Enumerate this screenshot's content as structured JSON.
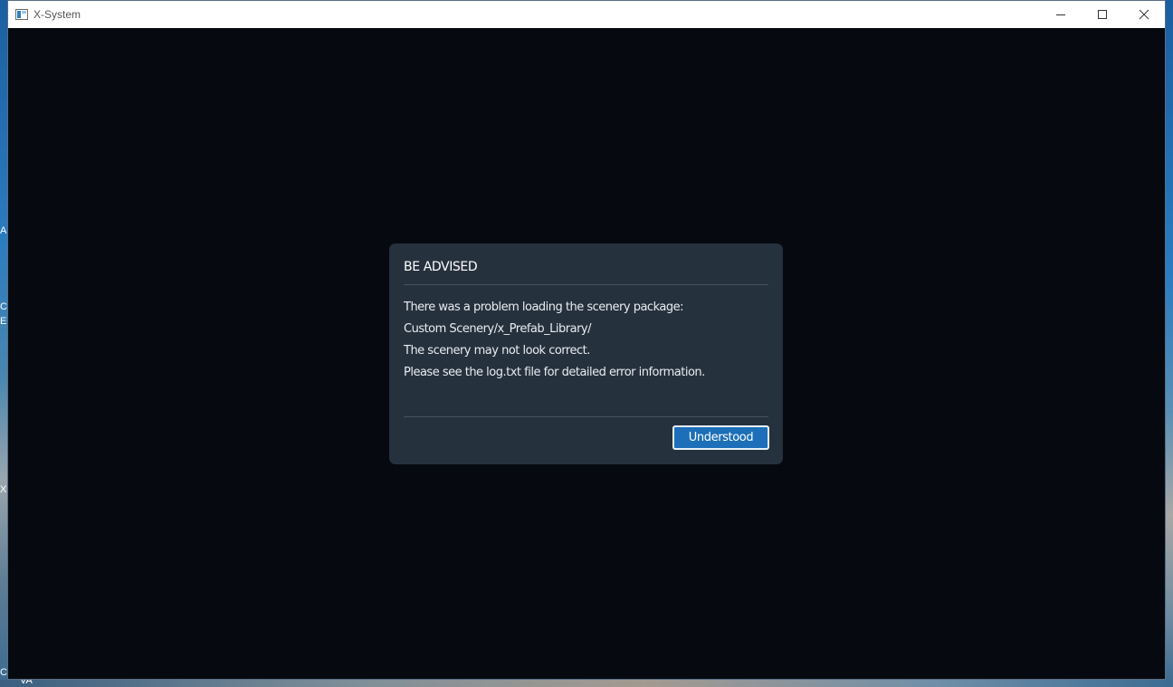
{
  "window": {
    "title": "X-System"
  },
  "desktop": {
    "peek_letters": [
      "A",
      "C",
      "E",
      "X",
      "C",
      "VA"
    ]
  },
  "dialog": {
    "title": "BE ADVISED",
    "message_lines": [
      "There was a problem loading the scenery package:",
      "Custom Scenery/x_Prefab_Library/",
      "The scenery may not look correct.",
      "Please see the log.txt file for detailed error information."
    ],
    "button_label": "Understood"
  },
  "colors": {
    "window_bg": "#060a10",
    "dialog_bg": "#26313e",
    "button_accent": "#1c6fb8"
  }
}
